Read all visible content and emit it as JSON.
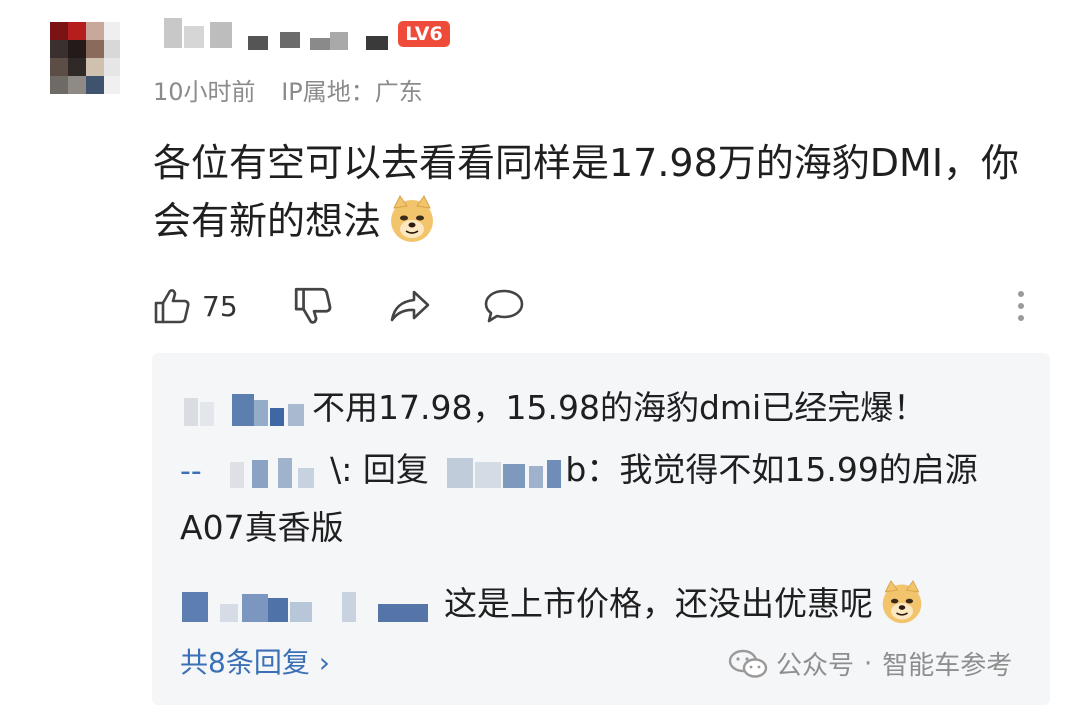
{
  "comment": {
    "level_badge": "LV6",
    "time": "10小时前",
    "ip_location": "IP属地：广东",
    "text_line1": "各位有空可以去看看同样是17.98万的海豹DMI，你",
    "text_line2": "会有新的想法",
    "like_count": "75",
    "emoji_icon": "doge-emoji-icon"
  },
  "replies": {
    "reply1_text": "不用17.98，15.98的海豹dmi已经完爆！",
    "reply2_prefix": "--",
    "reply2_colon": "\\: 回复",
    "reply2_trail": "b：我觉得不如15.99的启源",
    "reply2_line2": "A07真香版",
    "reply3_text": "这是上市价格，还没出优惠呢",
    "more_label": "共8条回复 ›"
  },
  "watermark": {
    "source": "公众号",
    "separator": "·",
    "name": "智能车参考"
  },
  "colors": {
    "badge": "#ef4b3b",
    "link": "#3b6fb6",
    "reply_bg": "#f4f6f8",
    "meta": "#8b8b8b"
  }
}
